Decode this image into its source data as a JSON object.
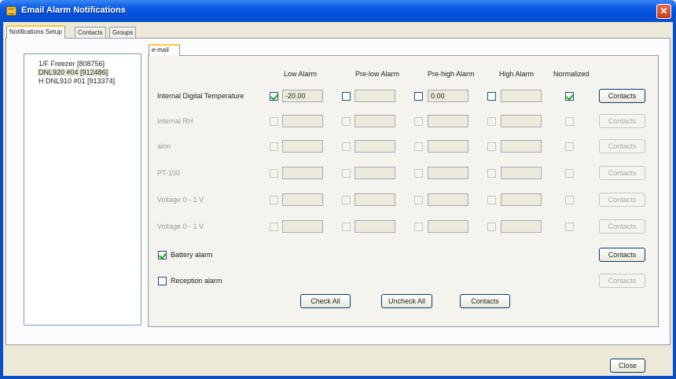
{
  "window": {
    "title": "Email Alarm Notifications",
    "close_glyph": "✕"
  },
  "tabs": [
    {
      "label": "Notifications Setup",
      "active": true
    },
    {
      "label": "Contacts",
      "active": false
    },
    {
      "label": "Groups",
      "active": false
    }
  ],
  "units": [
    {
      "label": "1/F Freezer [808756]",
      "selected": false
    },
    {
      "label": "DNL920 #04 [912486]",
      "selected": true
    },
    {
      "label": "H DNL910 #01 [913374]",
      "selected": false
    }
  ],
  "inner_tab": "e-mail",
  "columns": [
    "Low Alarm",
    "Pre-low Alarm",
    "Pre-high Alarm",
    "High Alarm",
    "Normalized"
  ],
  "rows": [
    {
      "label": "Internal Digital Temperature",
      "enabled": true,
      "alarms": [
        {
          "checked": true,
          "value": "-20.00"
        },
        {
          "checked": false,
          "value": ""
        },
        {
          "checked": false,
          "value": "0.00"
        },
        {
          "checked": false,
          "value": ""
        }
      ],
      "normalized": true,
      "contacts": "Contacts"
    },
    {
      "label": "Internal RH",
      "enabled": false,
      "alarms": [
        {
          "checked": false,
          "value": ""
        },
        {
          "checked": false,
          "value": ""
        },
        {
          "checked": false,
          "value": ""
        },
        {
          "checked": false,
          "value": ""
        }
      ],
      "normalized": false,
      "contacts": "Contacts"
    },
    {
      "label": "alon",
      "enabled": false,
      "alarms": [
        {
          "checked": false,
          "value": ""
        },
        {
          "checked": false,
          "value": ""
        },
        {
          "checked": false,
          "value": ""
        },
        {
          "checked": false,
          "value": ""
        }
      ],
      "normalized": false,
      "contacts": "Contacts"
    },
    {
      "label": "PT-100",
      "enabled": false,
      "alarms": [
        {
          "checked": false,
          "value": ""
        },
        {
          "checked": false,
          "value": ""
        },
        {
          "checked": false,
          "value": ""
        },
        {
          "checked": false,
          "value": ""
        }
      ],
      "normalized": false,
      "contacts": "Contacts"
    },
    {
      "label": "Voltage 0 - 1 V",
      "enabled": false,
      "alarms": [
        {
          "checked": false,
          "value": ""
        },
        {
          "checked": false,
          "value": ""
        },
        {
          "checked": false,
          "value": ""
        },
        {
          "checked": false,
          "value": ""
        }
      ],
      "normalized": false,
      "contacts": "Contacts"
    },
    {
      "label": "Voltage 0 - 1 V",
      "enabled": false,
      "alarms": [
        {
          "checked": false,
          "value": ""
        },
        {
          "checked": false,
          "value": ""
        },
        {
          "checked": false,
          "value": ""
        },
        {
          "checked": false,
          "value": ""
        }
      ],
      "normalized": false,
      "contacts": "Contacts"
    }
  ],
  "battery_alarm": {
    "label": "Battery alarm",
    "checked": true,
    "contacts": "Contacts"
  },
  "reception_alarm": {
    "label": "Reception alarm",
    "checked": false,
    "contacts": "Contacts"
  },
  "buttons": {
    "check_all": "Check All",
    "uncheck_all": "Uncheck All",
    "contacts": "Contacts",
    "close": "Close"
  }
}
